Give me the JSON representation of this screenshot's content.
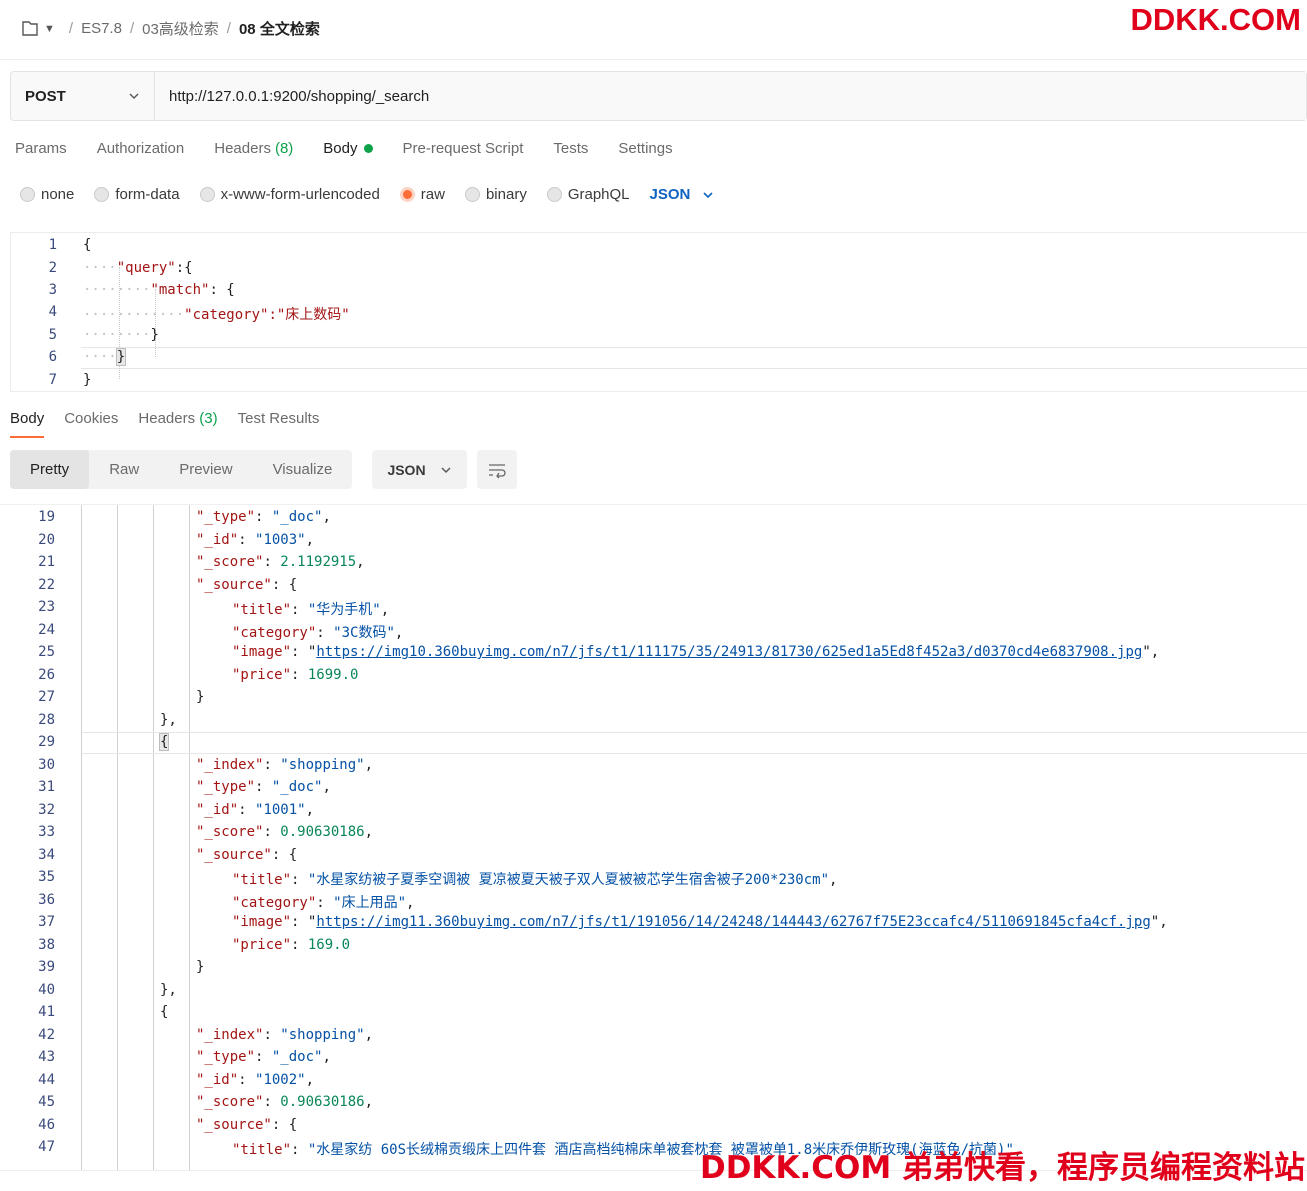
{
  "breadcrumb": {
    "items": [
      "ES7.8",
      "03高级检索"
    ],
    "current": "08 全文检索"
  },
  "watermark": {
    "top": "DDKK.COM",
    "bottom": "DDKK.COM 弟弟快看，程序员编程资料站"
  },
  "request": {
    "method": "POST",
    "url": "http://127.0.0.1:9200/shopping/_search",
    "tabs": [
      {
        "label": "Params"
      },
      {
        "label": "Authorization"
      },
      {
        "label": "Headers",
        "count": "(8)"
      },
      {
        "label": "Body",
        "active": true
      },
      {
        "label": "Pre-request Script"
      },
      {
        "label": "Tests"
      },
      {
        "label": "Settings"
      }
    ],
    "body_types": [
      "none",
      "form-data",
      "x-www-form-urlencoded",
      "raw",
      "binary",
      "GraphQL"
    ],
    "selected_body_type": "raw",
    "body_format": "JSON",
    "editor_lines": [
      {
        "n": "1",
        "text": "{"
      },
      {
        "n": "2",
        "key": "\"query\"",
        "rest": ":{"
      },
      {
        "n": "3",
        "key": "\"match\"",
        "rest": ": {"
      },
      {
        "n": "4",
        "key": "\"category\"",
        "rest": ":\"床上数码\""
      },
      {
        "n": "5",
        "text": "}"
      },
      {
        "n": "6",
        "text": "}"
      },
      {
        "n": "7",
        "text": "}"
      }
    ]
  },
  "response": {
    "tabs": [
      {
        "label": "Body",
        "active": true
      },
      {
        "label": "Cookies"
      },
      {
        "label": "Headers",
        "count": "(3)"
      },
      {
        "label": "Test Results"
      }
    ],
    "views": [
      "Pretty",
      "Raw",
      "Preview",
      "Visualize"
    ],
    "active_view": "Pretty",
    "format": "JSON",
    "lines": [
      {
        "n": "19",
        "indent": 4,
        "k": "\"_type\"",
        "v": "\"_doc\"",
        "vt": "s",
        "tail": ","
      },
      {
        "n": "20",
        "indent": 4,
        "k": "\"_id\"",
        "v": "\"1003\"",
        "vt": "s",
        "tail": ","
      },
      {
        "n": "21",
        "indent": 4,
        "k": "\"_score\"",
        "v": "2.1192915",
        "vt": "n",
        "tail": ","
      },
      {
        "n": "22",
        "indent": 4,
        "k": "\"_source\"",
        "v": "{",
        "vt": "p",
        "tail": ""
      },
      {
        "n": "23",
        "indent": 5,
        "k": "\"title\"",
        "v": "\"华为手机\"",
        "vt": "s",
        "tail": ","
      },
      {
        "n": "24",
        "indent": 5,
        "k": "\"category\"",
        "v": "\"3C数码\"",
        "vt": "s",
        "tail": ","
      },
      {
        "n": "25",
        "indent": 5,
        "k": "\"image\"",
        "v": "https://img10.360buyimg.com/n7/jfs/t1/111175/35/24913/81730/625ed1a5Ed8f452a3/d0370cd4e6837908.jpg",
        "vt": "l",
        "tail": ","
      },
      {
        "n": "26",
        "indent": 5,
        "k": "\"price\"",
        "v": "1699.0",
        "vt": "n",
        "tail": ""
      },
      {
        "n": "27",
        "indent": 4,
        "p": "}"
      },
      {
        "n": "28",
        "indent": 3,
        "p": "},"
      },
      {
        "n": "29",
        "indent": 3,
        "p": "{"
      },
      {
        "n": "30",
        "indent": 4,
        "k": "\"_index\"",
        "v": "\"shopping\"",
        "vt": "s",
        "tail": ","
      },
      {
        "n": "31",
        "indent": 4,
        "k": "\"_type\"",
        "v": "\"_doc\"",
        "vt": "s",
        "tail": ","
      },
      {
        "n": "32",
        "indent": 4,
        "k": "\"_id\"",
        "v": "\"1001\"",
        "vt": "s",
        "tail": ","
      },
      {
        "n": "33",
        "indent": 4,
        "k": "\"_score\"",
        "v": "0.90630186",
        "vt": "n",
        "tail": ","
      },
      {
        "n": "34",
        "indent": 4,
        "k": "\"_source\"",
        "v": "{",
        "vt": "p",
        "tail": ""
      },
      {
        "n": "35",
        "indent": 5,
        "k": "\"title\"",
        "v": "\"水星家纺被子夏季空调被 夏凉被夏天被子双人夏被被芯学生宿舍被子200*230cm\"",
        "vt": "s",
        "tail": ","
      },
      {
        "n": "36",
        "indent": 5,
        "k": "\"category\"",
        "v": "\"床上用品\"",
        "vt": "s",
        "tail": ","
      },
      {
        "n": "37",
        "indent": 5,
        "k": "\"image\"",
        "v": "https://img11.360buyimg.com/n7/jfs/t1/191056/14/24248/144443/62767f75E23ccafc4/5110691845cfa4cf.jpg",
        "vt": "l",
        "tail": ","
      },
      {
        "n": "38",
        "indent": 5,
        "k": "\"price\"",
        "v": "169.0",
        "vt": "n",
        "tail": ""
      },
      {
        "n": "39",
        "indent": 4,
        "p": "}"
      },
      {
        "n": "40",
        "indent": 3,
        "p": "},"
      },
      {
        "n": "41",
        "indent": 3,
        "p": "{"
      },
      {
        "n": "42",
        "indent": 4,
        "k": "\"_index\"",
        "v": "\"shopping\"",
        "vt": "s",
        "tail": ","
      },
      {
        "n": "43",
        "indent": 4,
        "k": "\"_type\"",
        "v": "\"_doc\"",
        "vt": "s",
        "tail": ","
      },
      {
        "n": "44",
        "indent": 4,
        "k": "\"_id\"",
        "v": "\"1002\"",
        "vt": "s",
        "tail": ","
      },
      {
        "n": "45",
        "indent": 4,
        "k": "\"_score\"",
        "v": "0.90630186",
        "vt": "n",
        "tail": ","
      },
      {
        "n": "46",
        "indent": 4,
        "k": "\"_source\"",
        "v": "{",
        "vt": "p",
        "tail": ""
      },
      {
        "n": "47",
        "indent": 5,
        "k": "\"title\"",
        "v": "\"水星家纺 60S长绒棉贡缎床上四件套 酒店高档纯棉床单被套枕套 被罩被单1.8米床乔伊斯玫瑰(海蓝色/抗菌)\"",
        "vt": "s",
        "tail": ","
      }
    ]
  }
}
